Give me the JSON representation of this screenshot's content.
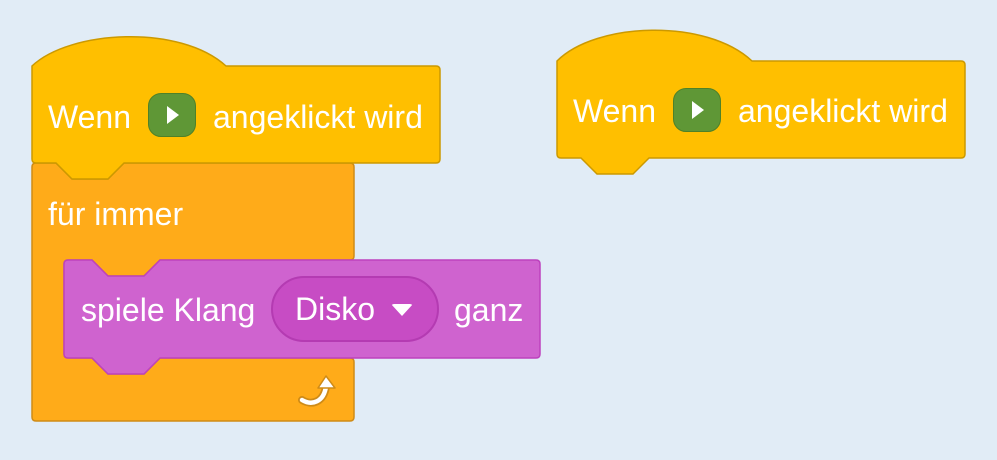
{
  "workspace": {
    "background": "#e1ecf6"
  },
  "colors": {
    "events_fill": "#ffbf00",
    "events_stroke": "#cc9900",
    "control_fill": "#ffab19",
    "control_stroke": "#cf8b17",
    "sound_fill": "#cf63cf",
    "sound_stroke": "#bd42bd",
    "sound_dropdown": "#c74cc4",
    "flag_green": "#5f9736"
  },
  "script1": {
    "hat": {
      "label_when": "Wenn",
      "flag_icon": "green-flag-icon",
      "label_clicked": "angeklickt wird"
    },
    "forever": {
      "label": "für immer",
      "loop_icon": "loop-arrow-icon"
    },
    "play_sound": {
      "label_play": "spiele Klang",
      "sound_name": "Disko",
      "label_until_done": "ganz"
    }
  },
  "script2": {
    "hat": {
      "label_when": "Wenn",
      "flag_icon": "green-flag-icon",
      "label_clicked": "angeklickt wird"
    }
  }
}
